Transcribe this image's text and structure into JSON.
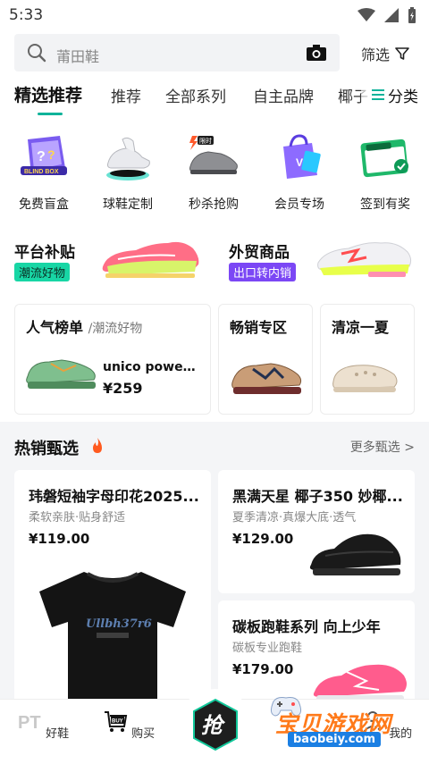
{
  "status": {
    "time": "5:33"
  },
  "search": {
    "placeholder": "莆田鞋",
    "filter_label": "筛选"
  },
  "tabs": [
    {
      "label": "精选推荐",
      "active": true
    },
    {
      "label": "推荐"
    },
    {
      "label": "全部系列"
    },
    {
      "label": "自主品牌"
    },
    {
      "label": "椰子"
    }
  ],
  "category_button": "分类",
  "quick_entries": [
    {
      "label": "免费盲盒",
      "icon": "blind-box-icon"
    },
    {
      "label": "球鞋定制",
      "icon": "custom-sneaker-icon"
    },
    {
      "label": "秒杀抢购",
      "icon": "flash-sale-icon",
      "badge": "限时"
    },
    {
      "label": "会员专场",
      "icon": "member-bag-icon"
    },
    {
      "label": "签到有奖",
      "icon": "checkin-calendar-icon"
    }
  ],
  "promos": [
    {
      "title": "平台补贴",
      "tag": "潮流好物"
    },
    {
      "title": "外贸商品",
      "tag": "出口转内销"
    }
  ],
  "ranking": {
    "hot": {
      "title": "人气榜单",
      "subtitle": "/潮流好物",
      "product_name": "unico power...",
      "price": "¥259"
    },
    "bestseller": {
      "title": "畅销专区"
    },
    "cool": {
      "title": "清凉一夏"
    }
  },
  "hot_section": {
    "title": "热销甄选",
    "more": "更多甄选 >"
  },
  "products": [
    {
      "name": "玮磐短袖字母印花2025...",
      "desc": "柔软亲肤·贴身舒适",
      "price": "¥119.00"
    },
    {
      "name": "黑满天星 椰子350 妙椰...",
      "desc": "夏季清凉·真爆大底·透气",
      "price": "¥129.00"
    },
    {
      "name": "碳板跑鞋系列 向上少年",
      "desc": "碳板专业跑鞋",
      "price": "¥179.00"
    }
  ],
  "bottom_nav": [
    {
      "label": "好鞋",
      "icon": "pt-icon"
    },
    {
      "label": "购买",
      "icon": "buy-cart-icon"
    },
    {
      "label": "抢",
      "icon": "grab-icon"
    },
    {
      "label": "我的",
      "icon": "profile-icon"
    }
  ],
  "watermark": {
    "text": "宝贝游戏网",
    "sub": "baobeiy.com"
  },
  "colors": {
    "accent": "#0fb39a",
    "green_tag": "#18d6a5",
    "purple_tag": "#7b47f5",
    "watermark": "#ff7a1a"
  }
}
